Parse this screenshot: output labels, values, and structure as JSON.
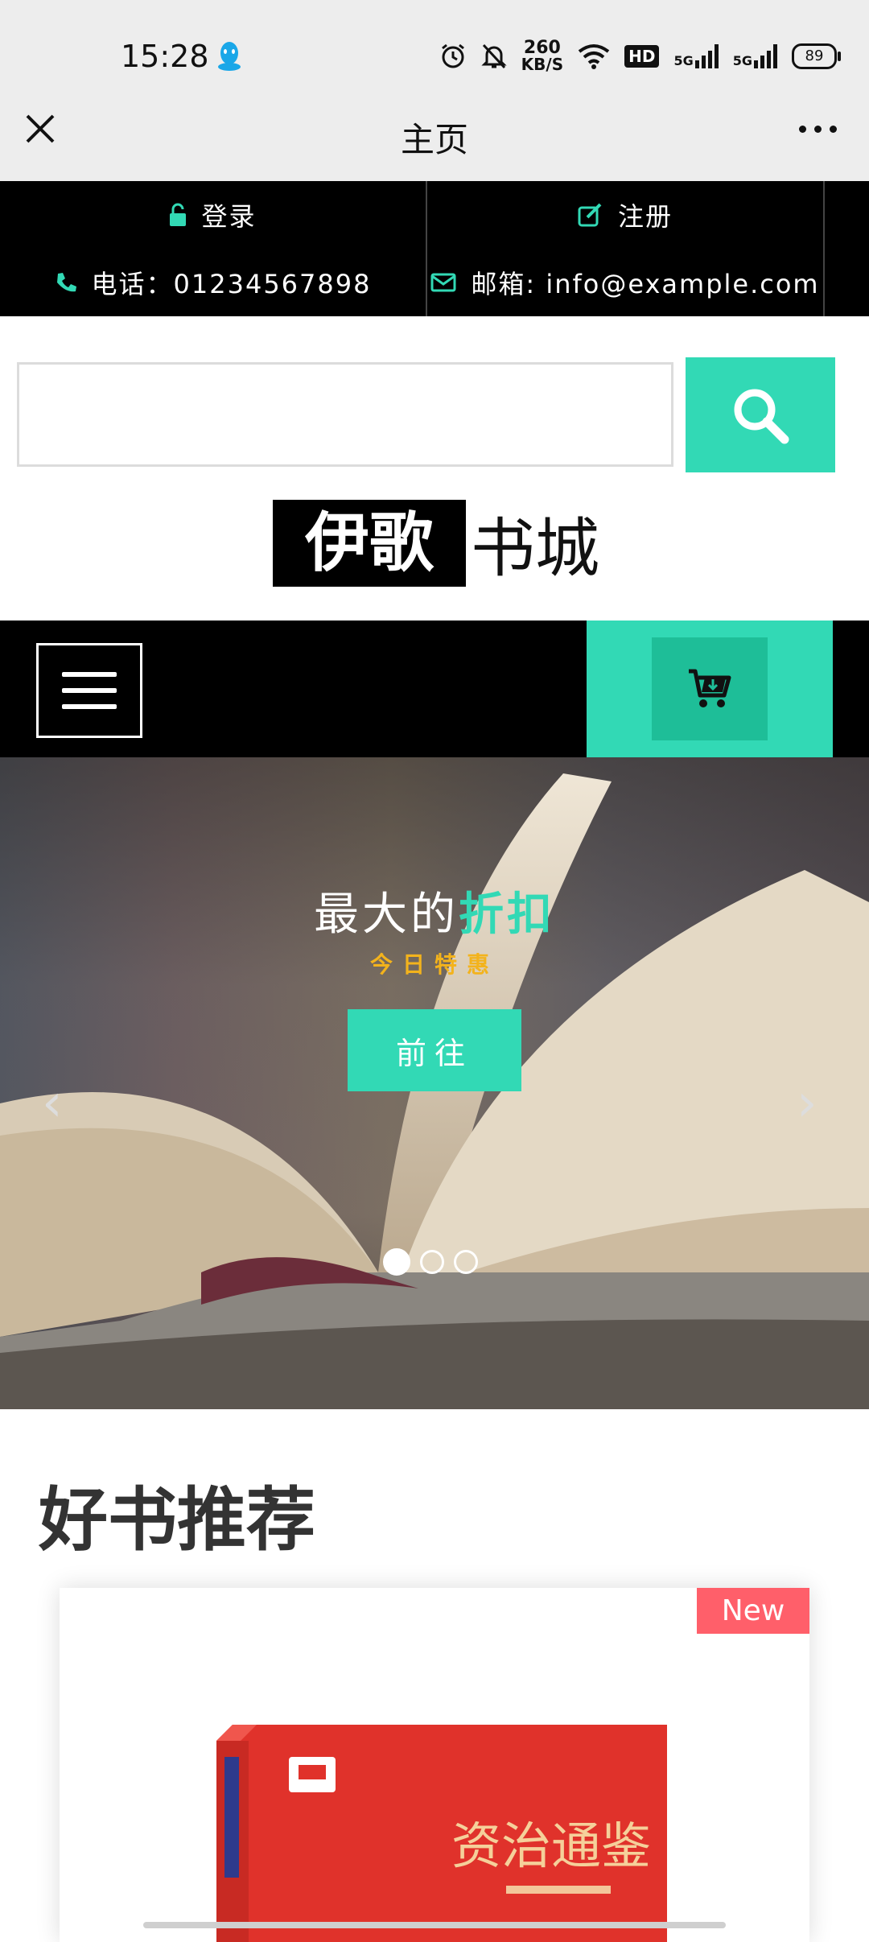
{
  "status_bar": {
    "time": "15:28",
    "net_speed_value": "260",
    "net_speed_unit": "KB/S",
    "hd_label": "HD",
    "sim1_label": "5G",
    "sim2_label": "5G",
    "battery": "89"
  },
  "title_bar": {
    "title": "主页"
  },
  "top_info": {
    "login": "登录",
    "register": "注册",
    "phone": "电话：01234567898",
    "email": "邮箱: info@example.com"
  },
  "search": {
    "placeholder": ""
  },
  "logo": {
    "part1": "伊歌",
    "part2": "书城"
  },
  "hero": {
    "title_main": "最大的",
    "title_accent": "折扣",
    "subtitle": "今日特惠",
    "button": "前往",
    "prev": "‹",
    "next": "›",
    "active_slide": 1,
    "slide_count": 3
  },
  "section": {
    "title": "好书推荐"
  },
  "product": {
    "badge": "New",
    "cover_title": "资治通鉴"
  },
  "colors": {
    "accent": "#32d9b5",
    "accent_dark": "#1ebe98",
    "badge": "#ff5f6a",
    "subtitle": "#f3b31c"
  }
}
